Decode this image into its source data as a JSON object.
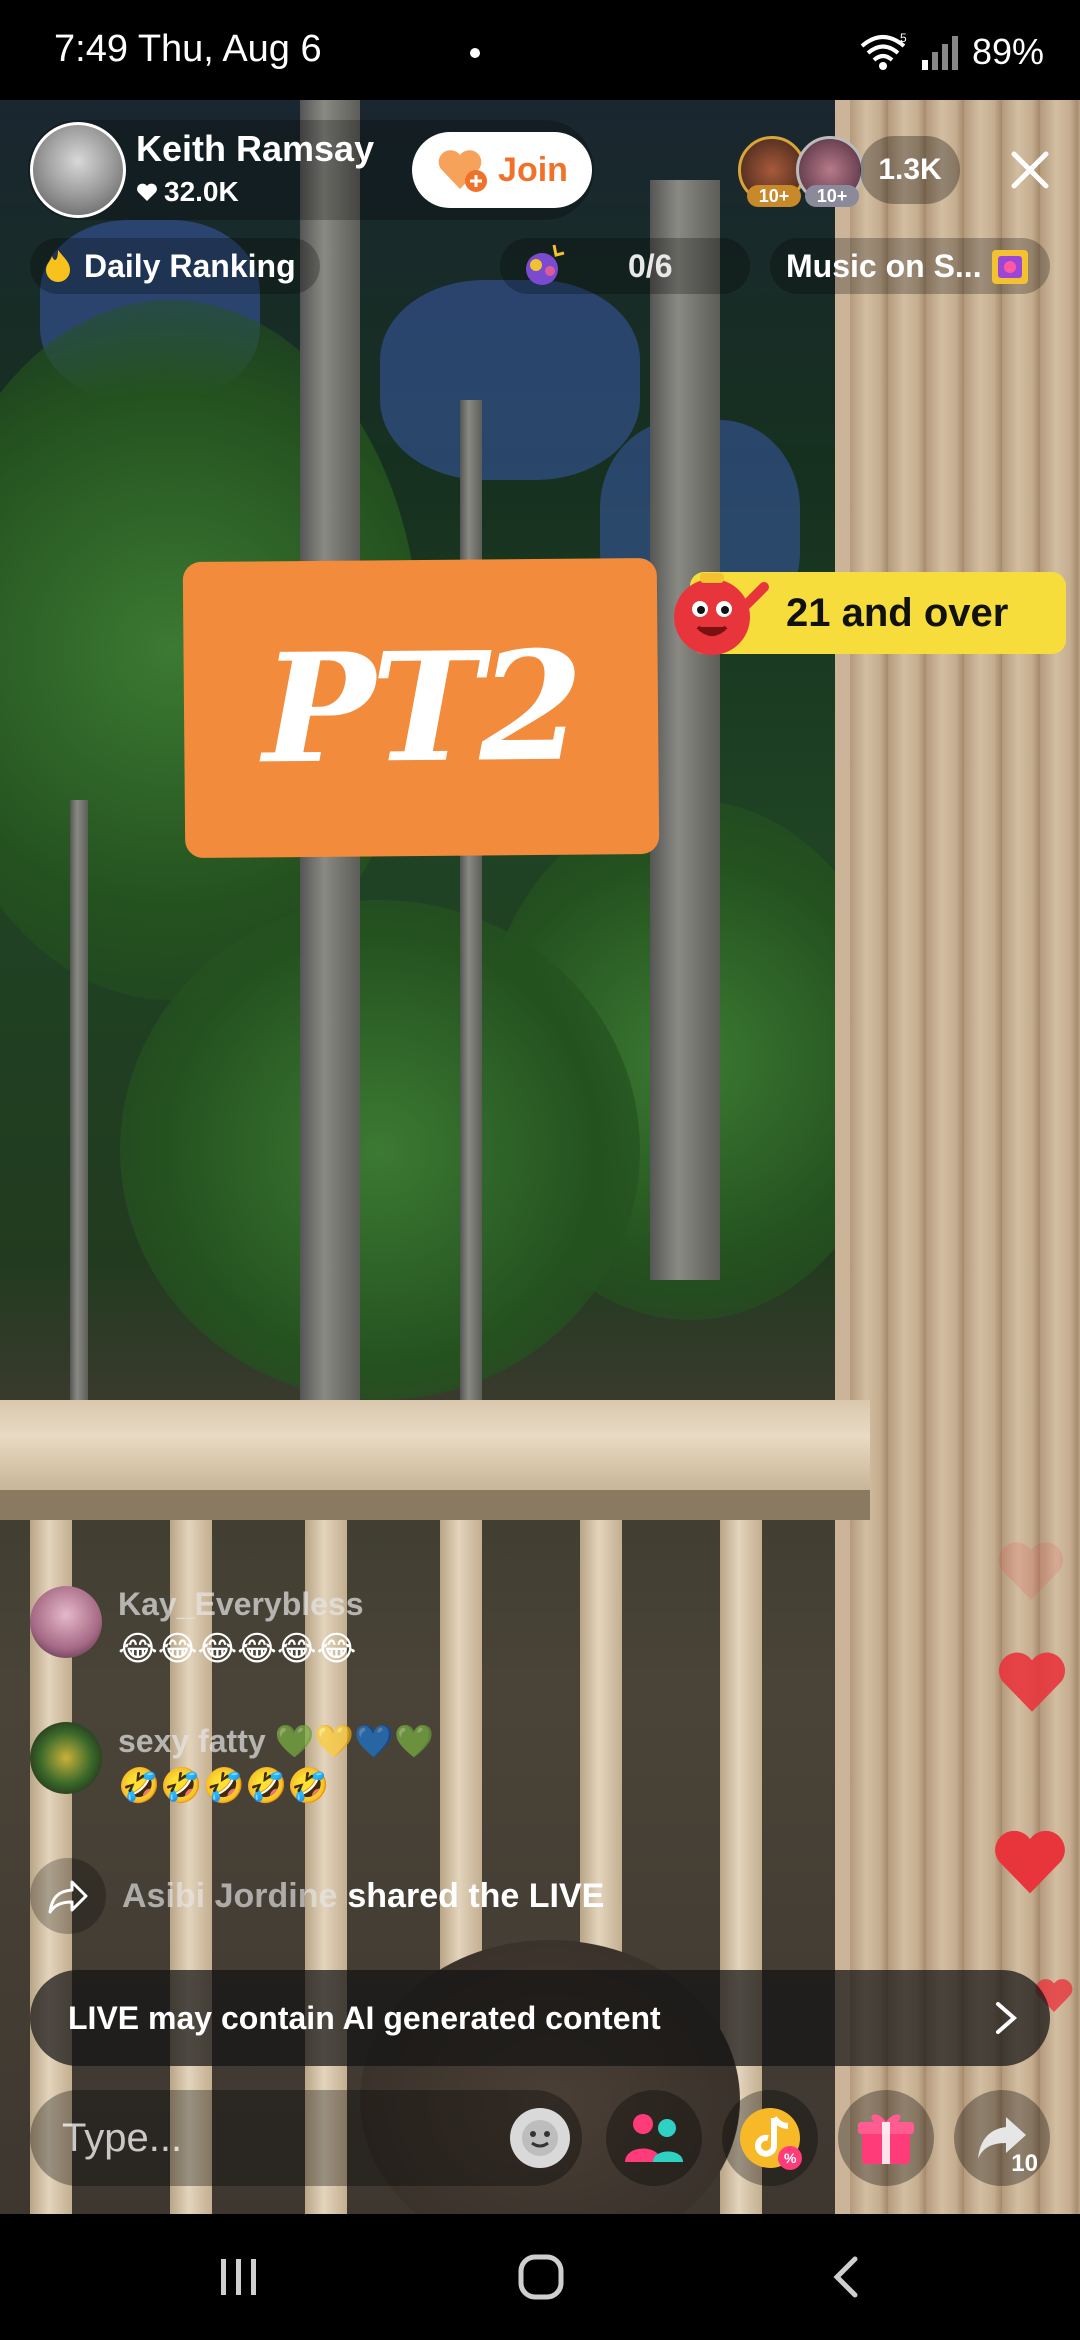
{
  "status_bar": {
    "time_date": "7:49  Thu, Aug 6",
    "battery": "89%",
    "wifi_badge": "5"
  },
  "host": {
    "name": "Keith Ramsay",
    "likes": "32.0K",
    "join_label": "Join"
  },
  "viewers": {
    "avatar_1_level": "10+",
    "avatar_2_level": "10+",
    "count": "1.3K"
  },
  "ranking": {
    "label": "Daily Ranking"
  },
  "goal": {
    "progress": "0/6",
    "current": 0,
    "target": 6
  },
  "music": {
    "label": "Music on S..."
  },
  "stickers": {
    "pt2": "PT2",
    "age": "21 and over"
  },
  "chat": [
    {
      "user": "Kay_Everybless",
      "text": "😂😂😂😂😂😂"
    },
    {
      "user": "sexy fatty 💚💛💙💚",
      "text": "🤣🤣🤣🤣🤣"
    }
  ],
  "share_event": {
    "user": "Asibi Jordine",
    "text": "shared the LIVE"
  },
  "ai_banner": {
    "text": "LIVE may contain AI generated content"
  },
  "bottom_bar": {
    "comment_placeholder": "Type...",
    "share_count": "10"
  },
  "colors": {
    "join_orange": "#f0722a",
    "pt2_orange": "#f38b3c",
    "age_yellow": "#f6dd3c",
    "heart_red": "#e8353c",
    "gift_pink": "#ff3b7a",
    "multiguest_teal": "#2fd1c4"
  },
  "icons": [
    "wifi-icon",
    "signal-icon",
    "heart-small-icon",
    "join-heart-icon",
    "close-icon",
    "fire-icon",
    "goal-icon",
    "music-icon",
    "share-arrow-icon",
    "chevron-right-icon",
    "emoji-icon",
    "multi-guest-icon",
    "promote-icon",
    "gift-icon",
    "share-icon",
    "recents-icon",
    "home-icon",
    "back-icon"
  ]
}
